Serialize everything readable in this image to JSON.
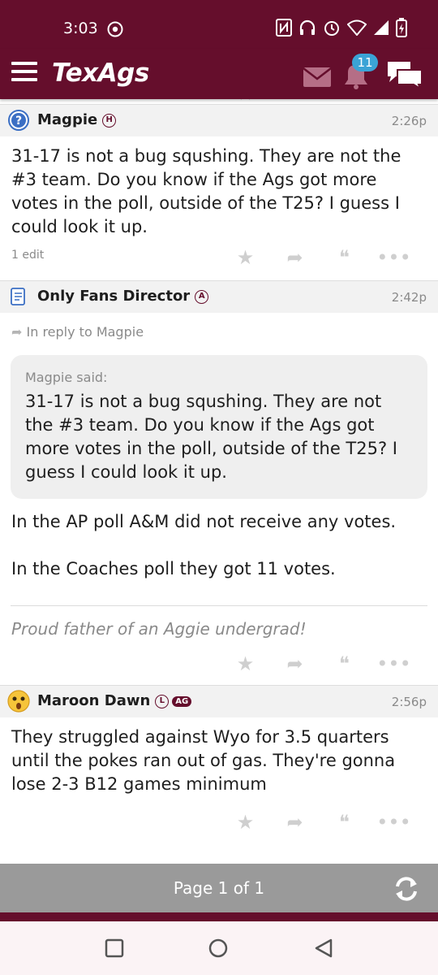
{
  "status_bar": {
    "time": "3:03",
    "icons": [
      "chrome-icon",
      "nfc-icon",
      "headphones-icon",
      "alarm-icon",
      "wifi-icon",
      "signal-icon",
      "battery-icon"
    ]
  },
  "app_bar": {
    "logo": "TexAgs",
    "notification_count": "11",
    "icons": [
      "menu-icon",
      "mail-icon",
      "bell-icon",
      "chat-icon"
    ]
  },
  "posts": [
    {
      "author": "Magpie",
      "badge": "H",
      "time": "2:26p",
      "body": "31-17 is not a bug squshing. They are not the #3 team. Do you know if the Ags got more votes in the poll, outside of the T25? I guess I could look it up.",
      "edit_note": "1 edit"
    },
    {
      "author": "Only Fans Director",
      "badge": "A",
      "time": "2:42p",
      "reply_to": "In reply to Magpie",
      "quote_author": "Magpie said:",
      "quote_text": "31-17 is not a bug squshing. They are not the #3 team. Do you know if the Ags got more votes in the poll, outside of the T25? I guess I could look it up.",
      "body_p1": "In the AP poll A&M did not receive any votes.",
      "body_p2": "In the Coaches poll they got 11 votes.",
      "signature": "Proud father of an Aggie undergrad!"
    },
    {
      "author": "Maroon Dawn",
      "badge": "L",
      "badge2": "AG",
      "time": "2:56p",
      "body": "They struggled against Wyo for 3.5 quarters until the pokes ran out of gas. They're gonna lose 2-3 B12 games minimum"
    }
  ],
  "pager": {
    "label": "Page 1 of 1"
  },
  "colors": {
    "brand": "#650e2c",
    "badge_blue": "#3ba3d6",
    "pager_gray": "#9a9a9a"
  }
}
